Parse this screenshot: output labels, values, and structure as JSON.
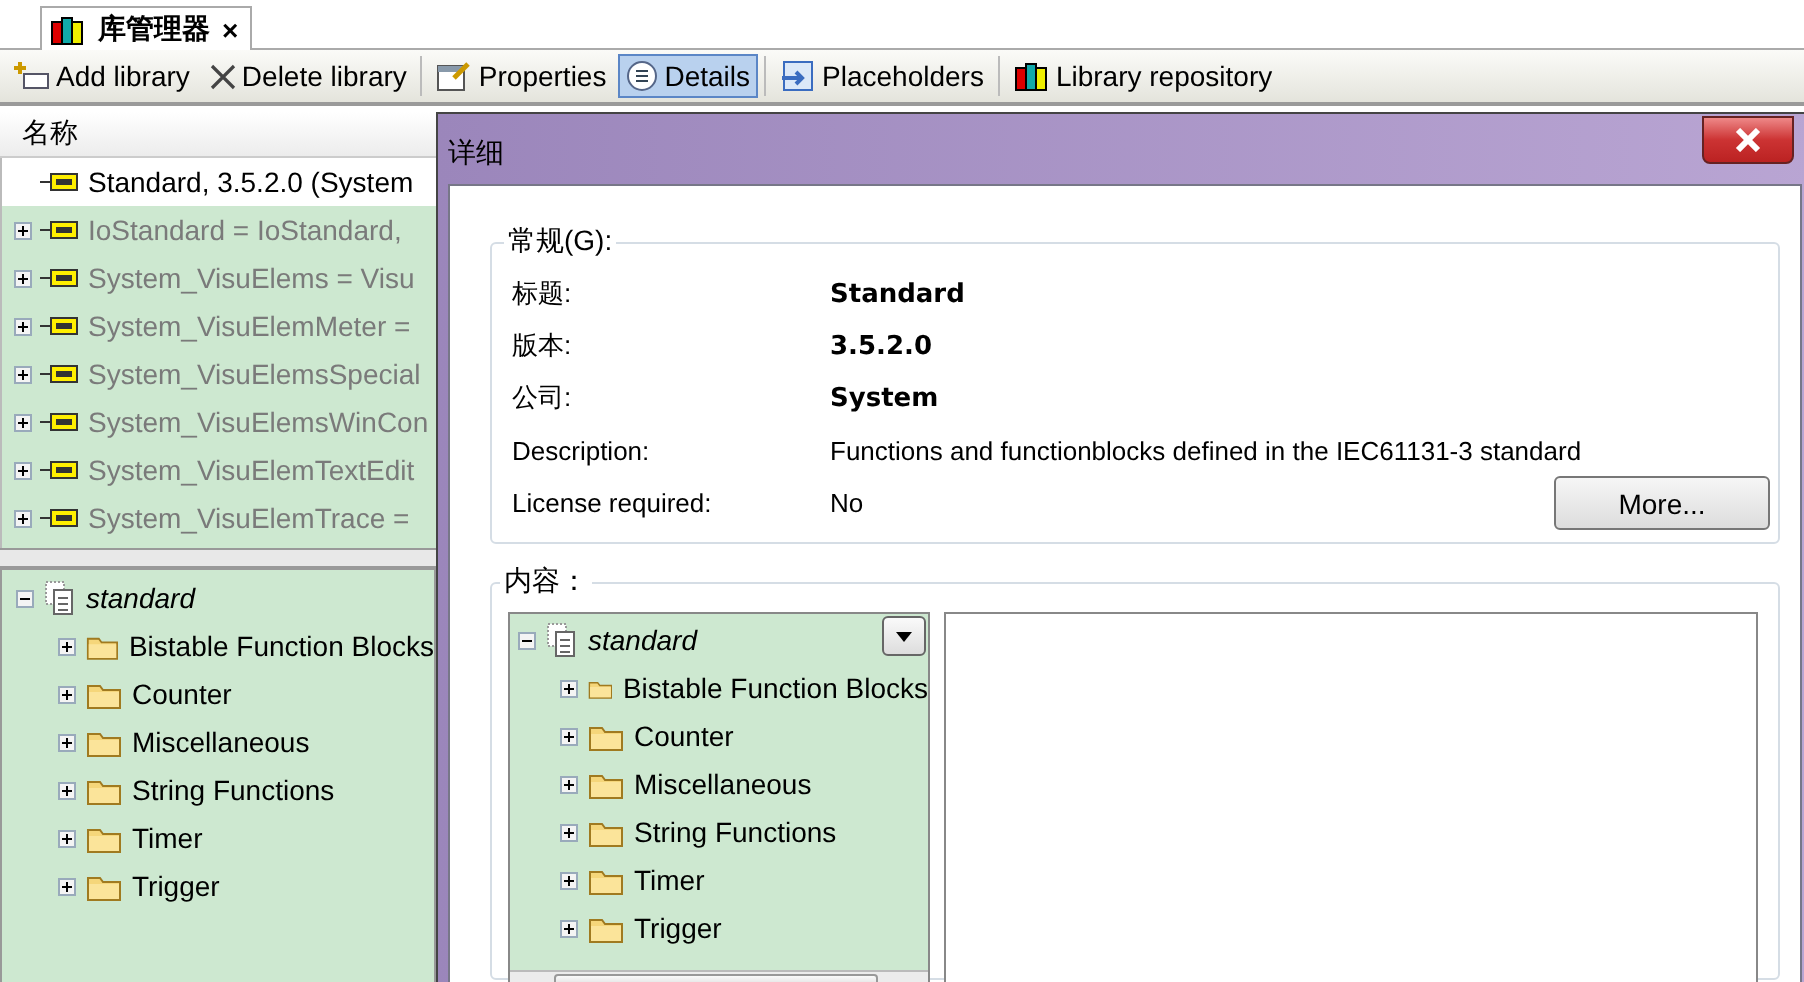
{
  "tab": {
    "title": "库管理器",
    "close": "×",
    "selected": true
  },
  "toolbar_groups": [
    [
      {
        "label": "Add library",
        "kind": "add",
        "selected": false
      },
      {
        "label": "Delete library",
        "kind": "delete",
        "selected": false
      }
    ],
    [
      {
        "label": "Properties",
        "kind": "properties",
        "selected": false
      },
      {
        "label": "Details",
        "kind": "details",
        "selected": true
      }
    ],
    [
      {
        "label": "Placeholders",
        "kind": "placeholders",
        "selected": false
      }
    ],
    [
      {
        "label": "Library repository",
        "kind": "repository",
        "selected": false
      }
    ]
  ],
  "library_list": {
    "header": "名称",
    "items": [
      {
        "label": "Standard, 3.5.2.0 (System",
        "selected": true,
        "disabled": false,
        "expandable": false
      },
      {
        "label": "IoStandard = IoStandard,",
        "selected": false,
        "disabled": true,
        "expandable": true
      },
      {
        "label": "System_VisuElems = Visu",
        "selected": false,
        "disabled": true,
        "expandable": true
      },
      {
        "label": "System_VisuElemMeter =",
        "selected": false,
        "disabled": true,
        "expandable": true
      },
      {
        "label": "System_VisuElemsSpecial",
        "selected": false,
        "disabled": true,
        "expandable": true
      },
      {
        "label": "System_VisuElemsWinCon",
        "selected": false,
        "disabled": true,
        "expandable": true
      },
      {
        "label": "System_VisuElemTextEdit",
        "selected": false,
        "disabled": true,
        "expandable": true
      },
      {
        "label": "System_VisuElemTrace =",
        "selected": false,
        "disabled": true,
        "expandable": true
      }
    ]
  },
  "category_tree": {
    "label": "standard",
    "expanded": true,
    "children": [
      {
        "label": "Bistable Function Blocks",
        "expanded": false
      },
      {
        "label": "Counter",
        "expanded": false
      },
      {
        "label": "Miscellaneous",
        "expanded": false
      },
      {
        "label": "String Functions",
        "expanded": false
      },
      {
        "label": "Timer",
        "expanded": false
      },
      {
        "label": "Trigger",
        "expanded": false
      }
    ]
  },
  "details_dialog": {
    "title": "详细",
    "general": {
      "legend": "常规(G):",
      "fields": [
        {
          "label": "标题:",
          "value": "Standard",
          "emphasis": true
        },
        {
          "label": "版本:",
          "value": "3.5.2.0",
          "emphasis": true
        },
        {
          "label": "公司:",
          "value": "System",
          "emphasis": true
        },
        {
          "label": "Description:",
          "value": "Functions and functionblocks defined in the IEC61131-3 standard",
          "emphasis": false
        },
        {
          "label": "License required:",
          "value": "No",
          "emphasis": false
        }
      ],
      "more_button": "More..."
    },
    "content": {
      "legend": "内容：",
      "tree": {
        "label": "standard",
        "expanded": true,
        "children": [
          {
            "label": "Bistable Function Blocks",
            "expanded": false
          },
          {
            "label": "Counter",
            "expanded": false
          },
          {
            "label": "Miscellaneous",
            "expanded": false
          },
          {
            "label": "String Functions",
            "expanded": false
          },
          {
            "label": "Timer",
            "expanded": false
          },
          {
            "label": "Trigger",
            "expanded": false
          }
        ]
      }
    }
  }
}
